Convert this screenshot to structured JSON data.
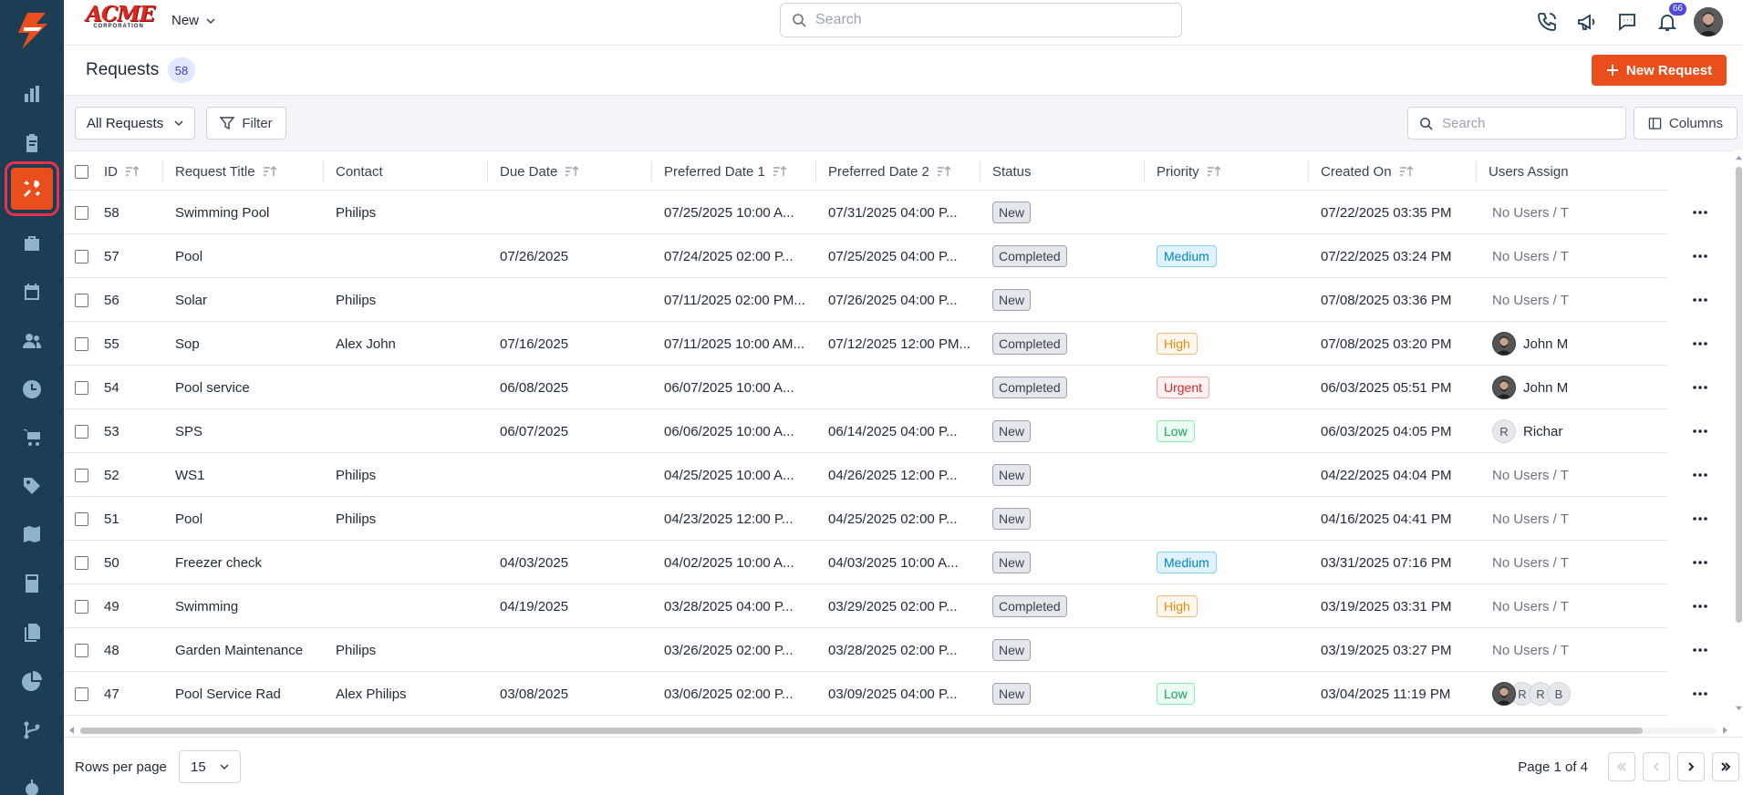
{
  "app": {
    "brand_big": "ACME",
    "brand_small": "CORPORATION",
    "new_label": "New",
    "search_placeholder": "Search",
    "notification_count": "66"
  },
  "colors": {
    "accent": "#ea4e1c",
    "sidebar": "#1c3d53",
    "badge": "#4f46e5"
  },
  "sidebar": {
    "items": [
      {
        "icon": "bar-chart-icon"
      },
      {
        "icon": "clipboard-icon"
      },
      {
        "icon": "tools-icon",
        "active": true
      },
      {
        "icon": "briefcase-icon"
      },
      {
        "icon": "calendar-icon"
      },
      {
        "icon": "users-icon"
      },
      {
        "icon": "clock-icon"
      },
      {
        "icon": "cart-icon"
      },
      {
        "icon": "tag-icon"
      },
      {
        "icon": "map-icon"
      },
      {
        "icon": "calculator-icon"
      },
      {
        "icon": "documents-icon"
      },
      {
        "icon": "pie-chart-icon"
      },
      {
        "icon": "workflow-icon"
      },
      {
        "icon": "settings-icon"
      }
    ]
  },
  "page": {
    "title": "Requests",
    "count": "58",
    "new_button": "New Request"
  },
  "toolbar": {
    "view_label": "All Requests",
    "filter_label": "Filter",
    "search_placeholder": "Search",
    "columns_label": "Columns"
  },
  "table": {
    "columns": [
      "ID",
      "Request Title",
      "Contact",
      "Due Date",
      "Preferred Date 1",
      "Preferred Date 2",
      "Status",
      "Priority",
      "Created On",
      "Users Assign"
    ],
    "rows": [
      {
        "id": "58",
        "title": "Swimming Pool",
        "contact": "Philips",
        "due": "",
        "pref1": "07/25/2025 10:00 A...",
        "pref2": "07/31/2025 04:00 P...",
        "status": "New",
        "priority": "",
        "created": "07/22/2025 03:35 PM",
        "users": "No Users / T"
      },
      {
        "id": "57",
        "title": "Pool",
        "contact": "",
        "due": "07/26/2025",
        "pref1": "07/24/2025 02:00 P...",
        "pref2": "07/25/2025 04:00 P...",
        "status": "Completed",
        "priority": "Medium",
        "created": "07/22/2025 03:24 PM",
        "users": "No Users / T"
      },
      {
        "id": "56",
        "title": "Solar",
        "contact": "Philips",
        "due": "",
        "pref1": "07/11/2025 02:00 PM...",
        "pref2": "07/26/2025 04:00 P...",
        "status": "New",
        "priority": "",
        "created": "07/08/2025 03:36 PM",
        "users": "No Users / T"
      },
      {
        "id": "55",
        "title": "Sop",
        "contact": "Alex John",
        "due": "07/16/2025",
        "pref1": "07/11/2025 10:00 AM...",
        "pref2": "07/12/2025 12:00 PM...",
        "status": "Completed",
        "priority": "High",
        "created": "07/08/2025 03:20 PM",
        "users": "John M",
        "avatar": "photo"
      },
      {
        "id": "54",
        "title": "Pool service",
        "contact": "",
        "due": "06/08/2025",
        "pref1": "06/07/2025 10:00 A...",
        "pref2": "",
        "status": "Completed",
        "priority": "Urgent",
        "created": "06/03/2025 05:51 PM",
        "users": "John M",
        "avatar": "photo"
      },
      {
        "id": "53",
        "title": "SPS",
        "contact": "",
        "due": "06/07/2025",
        "pref1": "06/06/2025 10:00 A...",
        "pref2": "06/14/2025 04:00 P...",
        "status": "New",
        "priority": "Low",
        "created": "06/03/2025 04:05 PM",
        "users": "Richar",
        "avatar": "R"
      },
      {
        "id": "52",
        "title": "WS1",
        "contact": "Philips",
        "due": "",
        "pref1": "04/25/2025 10:00 A...",
        "pref2": "04/26/2025 12:00 P...",
        "status": "New",
        "priority": "",
        "created": "04/22/2025 04:04 PM",
        "users": "No Users / T"
      },
      {
        "id": "51",
        "title": "Pool",
        "contact": "Philips",
        "due": "",
        "pref1": "04/23/2025 12:00 P...",
        "pref2": "04/25/2025 02:00 P...",
        "status": "New",
        "priority": "",
        "created": "04/16/2025 04:41 PM",
        "users": "No Users / T"
      },
      {
        "id": "50",
        "title": "Freezer check",
        "contact": "",
        "due": "04/03/2025",
        "pref1": "04/02/2025 10:00 A...",
        "pref2": "04/03/2025 10:00 A...",
        "status": "New",
        "priority": "Medium",
        "created": "03/31/2025 07:16 PM",
        "users": "No Users / T"
      },
      {
        "id": "49",
        "title": "Swimming",
        "contact": "",
        "due": "04/19/2025",
        "pref1": "03/28/2025 04:00 P...",
        "pref2": "03/29/2025 02:00 P...",
        "status": "Completed",
        "priority": "High",
        "created": "03/19/2025 03:31 PM",
        "users": "No Users / T"
      },
      {
        "id": "48",
        "title": "Garden Maintenance",
        "contact": "Philips",
        "due": "",
        "pref1": "03/26/2025 02:00 P...",
        "pref2": "03/28/2025 02:00 P...",
        "status": "New",
        "priority": "",
        "created": "03/19/2025 03:27 PM",
        "users": "No Users / T"
      },
      {
        "id": "47",
        "title": "Pool Service Rad",
        "contact": "Alex Philips",
        "due": "03/08/2025",
        "pref1": "03/06/2025 02:00 P...",
        "pref2": "03/09/2025 04:00 P...",
        "status": "New",
        "priority": "Low",
        "created": "03/04/2025 11:19 PM",
        "users": "",
        "avatar": "stack",
        "stack": [
          "R",
          "R",
          "B"
        ]
      }
    ]
  },
  "footer": {
    "rows_per_page_label": "Rows per page",
    "rows_per_page_value": "15",
    "page_info": "Page 1 of 4"
  }
}
